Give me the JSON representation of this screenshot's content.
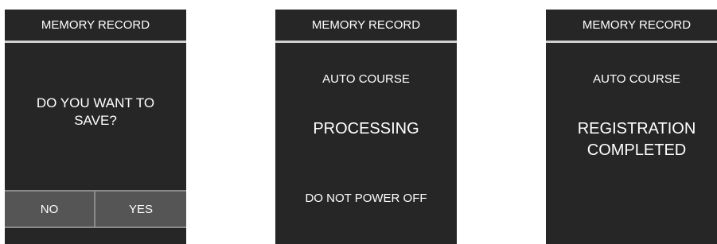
{
  "screens": [
    {
      "header": "MEMORY RECORD",
      "prompt_lines": [
        "DO YOU WANT TO",
        "SAVE?"
      ],
      "buttons": {
        "no": "NO",
        "yes": "YES"
      }
    },
    {
      "header": "MEMORY RECORD",
      "subtitle": "AUTO COURSE",
      "status": "PROCESSING",
      "warning": "DO NOT POWER OFF"
    },
    {
      "header": "MEMORY RECORD",
      "subtitle": "AUTO COURSE",
      "status_lines": [
        "REGISTRATION",
        "COMPLETED"
      ]
    }
  ],
  "colors": {
    "screen_bg": "#262626",
    "divider": "#d0d0d0",
    "button_bg": "#555555",
    "button_border": "#8a8a8a",
    "text": "#ffffff"
  }
}
